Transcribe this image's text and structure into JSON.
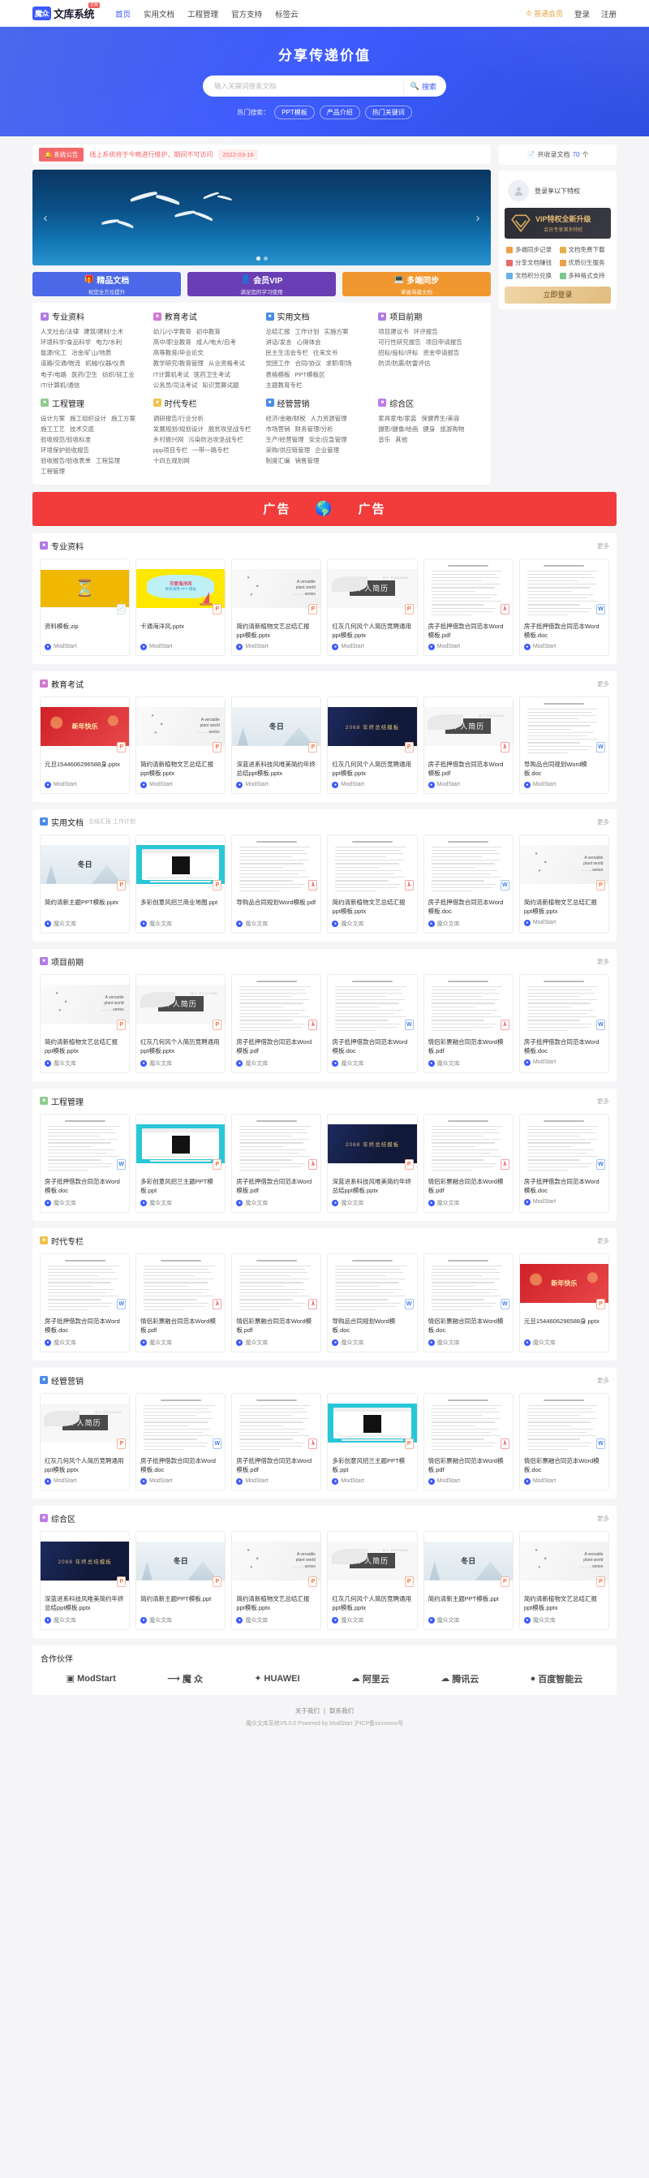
{
  "nav": {
    "brand_badge": "魔众",
    "brand_text": "文库系统",
    "brand_sup": "正版",
    "links": [
      {
        "label": "首页",
        "active": true
      },
      {
        "label": "实用文档",
        "active": false
      },
      {
        "label": "工程管理",
        "active": false
      },
      {
        "label": "官方支持",
        "active": false
      },
      {
        "label": "标签云",
        "active": false
      }
    ],
    "vip_label": "普通会员",
    "login": "登录",
    "register": "注册"
  },
  "hero": {
    "title": "分享传递价值",
    "search_placeholder": "输入关键词搜索文档",
    "search_value": "",
    "search_button": "搜索",
    "hot_label": "热门搜索：",
    "hot_tags": [
      "PPT模板",
      "产品介绍",
      "热门关键词"
    ]
  },
  "notice": {
    "badge": "系统公告",
    "text": "线上系统将于今晚进行维护，期间不可访问",
    "date": "2022-03-16"
  },
  "features": [
    {
      "title": "精品文档",
      "sub": "祝您全方位提升",
      "color": "#4a68e8",
      "icon": "gift-icon"
    },
    {
      "title": "会员VIP",
      "sub": "满足您的学习使用",
      "color": "#6a3fb5",
      "icon": "user-icon"
    },
    {
      "title": "多端同步",
      "sub": "掌握海量文档",
      "color": "#f0982f",
      "icon": "monitor-icon"
    }
  ],
  "categories": [
    {
      "title": "专业资料",
      "color": "#b07ae8",
      "links": [
        "人文社会/法律",
        "建筑/建材/土木",
        "环境科学/食品科学",
        "电力/水利",
        "能源/化工",
        "冶金/矿山/地质",
        "道路/交通/物流",
        "机械/仪器/仪表",
        "电子/电路",
        "医药/卫生",
        "纺织/轻工业",
        "IT/计算机/通信"
      ]
    },
    {
      "title": "教育考试",
      "color": "#d178d1",
      "links": [
        "幼儿/小学教育",
        "初中教育",
        "高中/职业教育",
        "成人/电大/自考",
        "高等教育/毕业论文",
        "教学研究/教育管理",
        "从业资格考试",
        "IT计算机考试",
        "医药卫生考试",
        "公务员/司法考试",
        "知识竞赛试题"
      ]
    },
    {
      "title": "实用文档",
      "color": "#4a8ae8",
      "links": [
        "总结汇报",
        "工作计划",
        "实施方案",
        "讲话/发言",
        "心得体会",
        "民主生活会专栏",
        "往来文书",
        "党团工作",
        "合同/协议",
        "求职/职场",
        "表格模板",
        "PPT模板区",
        "主题教育专栏"
      ]
    },
    {
      "title": "项目前期",
      "color": "#b07ae8",
      "links": [
        "项目建议书",
        "环评报告",
        "可行性研究报告",
        "项目申请报告",
        "招标/投标/评标",
        "资金申请报告",
        "防洪/防震/防雷评估"
      ]
    },
    {
      "title": "工程管理",
      "color": "#8fc98f",
      "links": [
        "设计方案",
        "施工组织设计",
        "施工方案",
        "施工工艺",
        "技术交底",
        "验收规范/验收标准",
        "环境保护验收报告",
        "验收报告/验收表单",
        "工程监理",
        "工程管理"
      ]
    },
    {
      "title": "时代专栏",
      "color": "#f0c14a",
      "links": [
        "调研报告/行业分析",
        "发展规划/规划设计",
        "脱贫攻坚战专栏",
        "乡村振兴网",
        "污染防治攻坚战专栏",
        "ppp项目专栏",
        "一带一路专栏",
        "十四五规划网"
      ]
    },
    {
      "title": "经管营销",
      "color": "#4a8ae8",
      "links": [
        "经济/金融/财税",
        "人力资源管理",
        "市场营销",
        "财务管理/分析",
        "生产/经营管理",
        "安全/应急管理",
        "采购/供应链管理",
        "企业管理",
        "制度汇编",
        "销售管理"
      ]
    },
    {
      "title": "综合区",
      "color": "#c07ae8",
      "links": [
        "家具家电/家装",
        "保健养生/美容",
        "摄影/摄像/绘画",
        "健身",
        "旅游购物",
        "音乐",
        "其他"
      ]
    }
  ],
  "sidebar": {
    "doc_count_prefix": "共收录文档",
    "doc_count": "70",
    "doc_count_suffix": "个",
    "login_tip": "登录享以下特权",
    "vip_title": "VIP特权全新升级",
    "vip_sub": "会员专享诸多特权",
    "privileges": [
      "多端同步记录",
      "文档免费下载",
      "分享文档赚钱",
      "优质衍生服务",
      "文档积分兑换",
      "多种格式支持"
    ],
    "login_button": "立即登录"
  },
  "ad": {
    "left": "广告",
    "right": "广告"
  },
  "sections": [
    {
      "title": "专业资料",
      "color": "#b07ae8",
      "sub": "",
      "more": "更多",
      "cards": [
        {
          "title": "资料模板.zip",
          "author": "ModStart",
          "ftype": "Z",
          "thumb": "yellow-hourglass"
        },
        {
          "title": "卡通海洋风.pptx",
          "author": "ModStart",
          "ftype": "P",
          "thumb": "cartoon-ocean"
        },
        {
          "title": "简约清新植物文艺总结汇报ppt模板.pptx",
          "author": "ModStart",
          "ftype": "P",
          "thumb": "plant"
        },
        {
          "title": "红灰几何风个人简历竞聘通用ppt模板.pptx",
          "author": "ModStart",
          "ftype": "P",
          "thumb": "resume"
        },
        {
          "title": "房子抵押借款合同范本Word模板.pdf",
          "author": "ModStart",
          "ftype": "A",
          "thumb": "doc"
        },
        {
          "title": "房子抵押借款合同范本Word模板.doc",
          "author": "ModStart",
          "ftype": "W",
          "thumb": "doc"
        }
      ]
    },
    {
      "title": "教育考试",
      "color": "#d178d1",
      "sub": "",
      "more": "更多",
      "cards": [
        {
          "title": "元旦1544606296588身.pptx",
          "author": "ModStart",
          "ftype": "P",
          "thumb": "red-festival"
        },
        {
          "title": "简约清新植物文艺总结汇报ppt模板.pptx",
          "author": "ModStart",
          "ftype": "P",
          "thumb": "plant"
        },
        {
          "title": "深蓝进系科技风唯美简约年终总结ppt模板.pptx",
          "author": "ModStart",
          "ftype": "P",
          "thumb": "winter"
        },
        {
          "title": "红灰几何风个人简历竞聘通用ppt模板.pptx",
          "author": "ModStart",
          "ftype": "P",
          "thumb": "navy"
        },
        {
          "title": "房子抵押借款合同范本Word模板.pdf",
          "author": "ModStart",
          "ftype": "A",
          "thumb": "resume"
        },
        {
          "title": "导购品合同规划Word模板.doc",
          "author": "ModStart",
          "ftype": "W",
          "thumb": "doc"
        }
      ]
    },
    {
      "title": "实用文档",
      "color": "#4a8ae8",
      "sub": "总结汇报 工作计划",
      "more": "更多",
      "cards": [
        {
          "title": "简约清新主题PPT模板.pptx",
          "author": "魔众文库",
          "ftype": "P",
          "thumb": "winter"
        },
        {
          "title": "多彩创意风招兰商业地图.ppt",
          "author": "魔众文库",
          "ftype": "P",
          "thumb": "cyan"
        },
        {
          "title": "导购品合同规划Word模板.pdf",
          "author": "魔众文库",
          "ftype": "A",
          "thumb": "doc"
        },
        {
          "title": "简约清新植物文艺总结汇报ppt模板.pptx",
          "author": "魔众文库",
          "ftype": "A",
          "thumb": "doc"
        },
        {
          "title": "房子抵押借款合同范本Word模板.doc",
          "author": "魔众文库",
          "ftype": "W",
          "thumb": "doc"
        },
        {
          "title": "简约清新植物文艺总结汇报ppt模板.pptx",
          "author": "ModStart",
          "ftype": "P",
          "thumb": "plant"
        }
      ]
    },
    {
      "title": "项目前期",
      "color": "#b07ae8",
      "sub": "",
      "more": "更多",
      "cards": [
        {
          "title": "简约清新植物文艺总结汇报ppt模板.pptx",
          "author": "魔众文库",
          "ftype": "P",
          "thumb": "plant"
        },
        {
          "title": "红灰几何风个人简历竞聘通用ppt模板.pptx",
          "author": "魔众文库",
          "ftype": "P",
          "thumb": "resume"
        },
        {
          "title": "房子抵押借款合同范本Word模板.pdf",
          "author": "魔众文库",
          "ftype": "A",
          "thumb": "doc"
        },
        {
          "title": "房子抵押借款合同范本Word模板.doc",
          "author": "魔众文库",
          "ftype": "W",
          "thumb": "doc"
        },
        {
          "title": "情侣彩票融合同范本Word模板.pdf",
          "author": "魔众文库",
          "ftype": "A",
          "thumb": "doc"
        },
        {
          "title": "房子抵押借款合同范本Word模板.doc",
          "author": "ModStart",
          "ftype": "W",
          "thumb": "doc"
        }
      ]
    },
    {
      "title": "工程管理",
      "color": "#8fc98f",
      "sub": "",
      "more": "更多",
      "cards": [
        {
          "title": "房子抵押借款合同范本Word模板.doc",
          "author": "魔众文库",
          "ftype": "W",
          "thumb": "doc"
        },
        {
          "title": "多彩创意风招兰主题PPT模板.ppt",
          "author": "魔众文库",
          "ftype": "P",
          "thumb": "cyan"
        },
        {
          "title": "房子抵押借款合同范本Word模板.pdf",
          "author": "魔众文库",
          "ftype": "A",
          "thumb": "doc"
        },
        {
          "title": "深蓝进系科技风唯美简约年终总结ppt模板.pptx",
          "author": "魔众文库",
          "ftype": "P",
          "thumb": "navy"
        },
        {
          "title": "情侣彩票融合同范本Word模板.pdf",
          "author": "魔众文库",
          "ftype": "A",
          "thumb": "doc"
        },
        {
          "title": "房子抵押借款合同范本Word模板.doc",
          "author": "ModStart",
          "ftype": "W",
          "thumb": "doc"
        }
      ]
    },
    {
      "title": "时代专栏",
      "color": "#f0c14a",
      "sub": "",
      "more": "更多",
      "cards": [
        {
          "title": "房子抵押借款合同范本Word模板.doc",
          "author": "魔众文库",
          "ftype": "W",
          "thumb": "doc"
        },
        {
          "title": "情侣彩票融合同范本Word模板.pdf",
          "author": "魔众文库",
          "ftype": "A",
          "thumb": "doc"
        },
        {
          "title": "情侣彩票融合同范本Word模板.pdf",
          "author": "魔众文库",
          "ftype": "A",
          "thumb": "doc"
        },
        {
          "title": "导购品合同规划Word模板.doc",
          "author": "魔众文库",
          "ftype": "W",
          "thumb": "doc"
        },
        {
          "title": "情侣彩票融合同范本Word模板.doc",
          "author": "魔众文库",
          "ftype": "W",
          "thumb": "doc"
        },
        {
          "title": "元旦1544606296588身.pptx",
          "author": "魔众文库",
          "ftype": "P",
          "thumb": "red-festival"
        }
      ]
    },
    {
      "title": "经管营销",
      "color": "#4a8ae8",
      "sub": "",
      "more": "更多",
      "cards": [
        {
          "title": "红灰几何风个人简历竞聘通用ppt模板.pptx",
          "author": "ModStart",
          "ftype": "P",
          "thumb": "resume"
        },
        {
          "title": "房子抵押借款合同范本Word模板.doc",
          "author": "ModStart",
          "ftype": "W",
          "thumb": "doc"
        },
        {
          "title": "房子抵押借款合同范本Word模板.pdf",
          "author": "ModStart",
          "ftype": "A",
          "thumb": "doc"
        },
        {
          "title": "多彩创意风招兰主题PPT模板.ppt",
          "author": "ModStart",
          "ftype": "P",
          "thumb": "cyan"
        },
        {
          "title": "情侣彩票融合同范本Word模板.pdf",
          "author": "ModStart",
          "ftype": "A",
          "thumb": "doc"
        },
        {
          "title": "情侣彩票融合同范本Word模板.doc",
          "author": "ModStart",
          "ftype": "W",
          "thumb": "doc"
        }
      ]
    },
    {
      "title": "综合区",
      "color": "#c07ae8",
      "sub": "",
      "more": "更多",
      "cards": [
        {
          "title": "深蓝进系科技风唯美简约年终总结ppt模板.pptx",
          "author": "魔众文库",
          "ftype": "P",
          "thumb": "navy"
        },
        {
          "title": "简约清新主题PPT模板.ppt",
          "author": "魔众文库",
          "ftype": "P",
          "thumb": "winter"
        },
        {
          "title": "简约清新植物文艺总结汇报ppt模板.pptx",
          "author": "魔众文库",
          "ftype": "P",
          "thumb": "plant"
        },
        {
          "title": "红灰几何风个人简历竞聘通用ppt模板.pptx",
          "author": "魔众文库",
          "ftype": "P",
          "thumb": "resume"
        },
        {
          "title": "简约清新主题PPT模板.ppt",
          "author": "魔众文库",
          "ftype": "P",
          "thumb": "winter"
        },
        {
          "title": "简约清新植物文艺总结汇报ppt模板.pptx",
          "author": "魔众文库",
          "ftype": "P",
          "thumb": "plant"
        }
      ]
    }
  ],
  "partners": {
    "title": "合作伙伴",
    "items": [
      "ModStart",
      "魔 众",
      "HUAWEI",
      "阿里云",
      "腾讯云",
      "百度智能云"
    ]
  },
  "footer": {
    "links": [
      "关于我们",
      "联系我们"
    ],
    "copyright": "魔众文库系统V5.0.0 Powered by ModStart 沪ICP备xxxxxxxx号"
  }
}
